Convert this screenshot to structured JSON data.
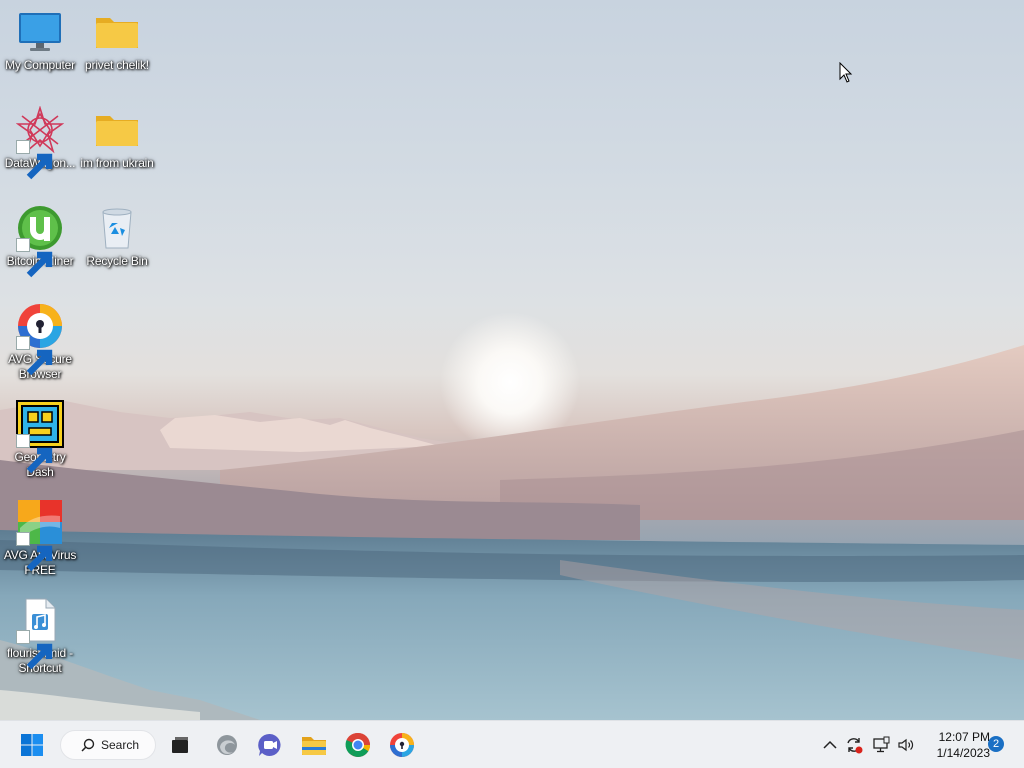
{
  "desktop": {
    "icons": [
      {
        "label": "My Computer",
        "icon": "monitor-icon"
      },
      {
        "label": "privet chelik!",
        "icon": "folder-icon"
      },
      {
        "label": "DataWagon...",
        "icon": "datawagon-icon"
      },
      {
        "label": "im from ukrain",
        "icon": "folder-icon"
      },
      {
        "label": "Bitcoin Miner",
        "icon": "utorrent-icon"
      },
      {
        "label": "Recycle Bin",
        "icon": "recycle-bin-icon"
      },
      {
        "label": "AVG Secure Browser",
        "icon": "avg-secure-browser-icon"
      },
      {
        "label": "Geometry Dash",
        "icon": "geometry-dash-icon"
      },
      {
        "label": "AVG AntiVirus FREE",
        "icon": "avg-antivirus-icon"
      },
      {
        "label": "flourish.mid - Shortcut",
        "icon": "midi-file-icon"
      }
    ]
  },
  "taskbar": {
    "search_label": "Search",
    "apps": [
      "start-icon",
      "task-view-icon",
      "edge-icon",
      "teams-chat-icon",
      "file-explorer-icon",
      "chrome-icon",
      "avg-browser-icon"
    ],
    "tray": [
      "chevron-up-icon",
      "sync-icon",
      "network-icon",
      "volume-icon"
    ],
    "clock": {
      "time": "12:07 PM",
      "date": "1/14/2023"
    },
    "notification_count": "2"
  },
  "colors": {
    "taskbar": "#eef0f3",
    "accent": "#0078d4",
    "folder": "#f5c542"
  }
}
